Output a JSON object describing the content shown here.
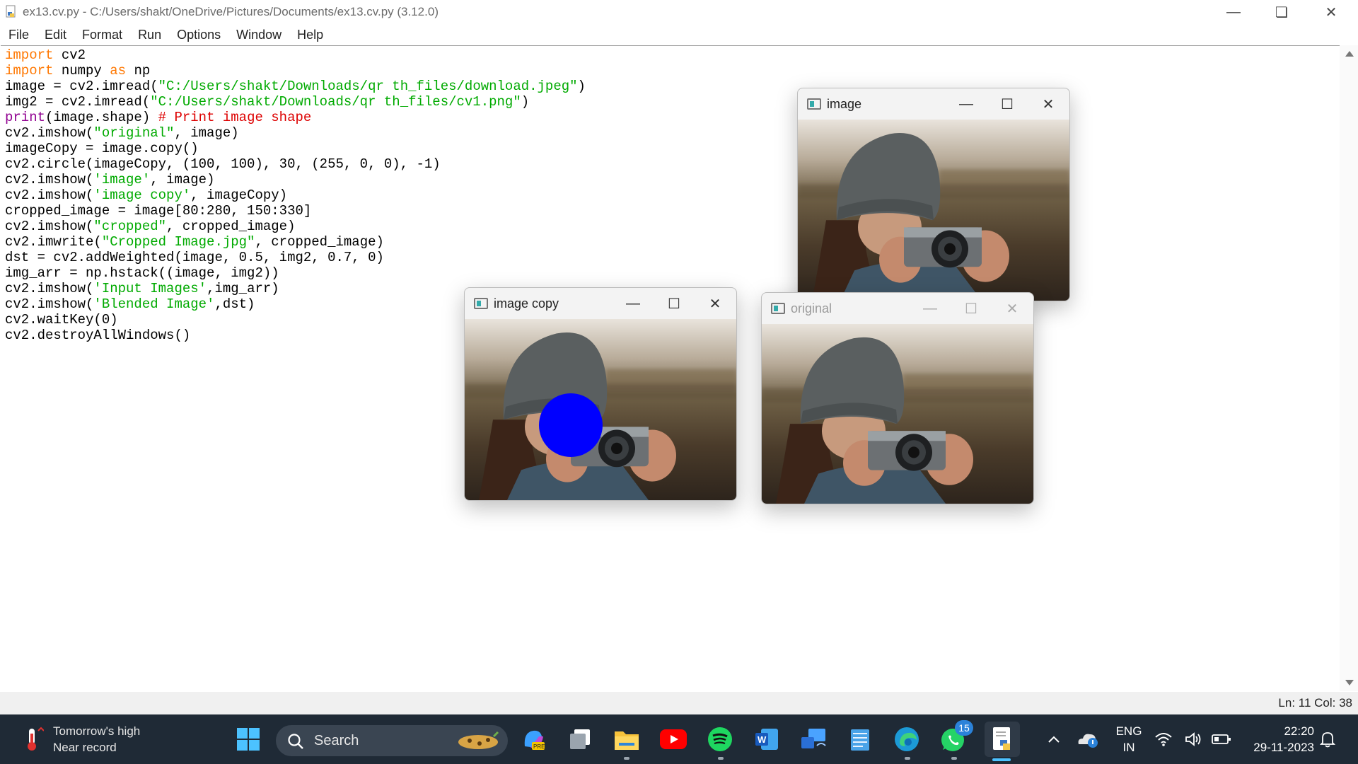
{
  "window": {
    "title": "ex13.cv.py - C:/Users/shakt/OneDrive/Pictures/Documents/ex13.cv.py (3.12.0)",
    "minimize_icon": "minimize-icon",
    "restore_icon": "restore-icon",
    "close_icon": "close-icon"
  },
  "menu": [
    "File",
    "Edit",
    "Format",
    "Run",
    "Options",
    "Window",
    "Help"
  ],
  "code_lines": [
    [
      {
        "t": "import",
        "c": "kw"
      },
      {
        "t": " cv2",
        "c": ""
      }
    ],
    [
      {
        "t": "import",
        "c": "kw"
      },
      {
        "t": " numpy ",
        "c": ""
      },
      {
        "t": "as",
        "c": "kw"
      },
      {
        "t": " np",
        "c": ""
      }
    ],
    [
      {
        "t": "image = cv2.imread(",
        "c": ""
      },
      {
        "t": "\"C:/Users/shakt/Downloads/qr th_files/download.jpeg\"",
        "c": "str"
      },
      {
        "t": ")",
        "c": ""
      }
    ],
    [
      {
        "t": "img2 = cv2.imread(",
        "c": ""
      },
      {
        "t": "\"C:/Users/shakt/Downloads/qr th_files/cv1.png\"",
        "c": "str"
      },
      {
        "t": ")",
        "c": ""
      }
    ],
    [
      {
        "t": "print",
        "c": "bi"
      },
      {
        "t": "(image.shape) ",
        "c": ""
      },
      {
        "t": "# Print image shape",
        "c": "cm"
      }
    ],
    [
      {
        "t": "cv2.imshow(",
        "c": ""
      },
      {
        "t": "\"original\"",
        "c": "str"
      },
      {
        "t": ", image)",
        "c": ""
      }
    ],
    [
      {
        "t": "imageCopy = image.copy()",
        "c": ""
      }
    ],
    [
      {
        "t": "cv2.circle(imageCopy, (100, 100), 30, (255, 0, 0), -1)",
        "c": ""
      }
    ],
    [
      {
        "t": "cv2.imshow(",
        "c": ""
      },
      {
        "t": "'image'",
        "c": "str"
      },
      {
        "t": ", image)",
        "c": ""
      }
    ],
    [
      {
        "t": "cv2.imshow(",
        "c": ""
      },
      {
        "t": "'image copy'",
        "c": "str"
      },
      {
        "t": ", imageCopy)",
        "c": ""
      }
    ],
    [
      {
        "t": "cropped_image = image[80:280, 150:330]",
        "c": ""
      }
    ],
    [
      {
        "t": "cv2.imshow(",
        "c": ""
      },
      {
        "t": "\"cropped\"",
        "c": "str"
      },
      {
        "t": ", cropped_image)",
        "c": ""
      }
    ],
    [
      {
        "t": "cv2.imwrite(",
        "c": ""
      },
      {
        "t": "\"Cropped Image.jpg\"",
        "c": "str"
      },
      {
        "t": ", cropped_image)",
        "c": ""
      }
    ],
    [
      {
        "t": "dst = cv2.addWeighted(image, 0.5, img2, 0.7, 0)",
        "c": ""
      }
    ],
    [
      {
        "t": "img_arr = np.hstack((image, img2))",
        "c": ""
      }
    ],
    [
      {
        "t": "cv2.imshow(",
        "c": ""
      },
      {
        "t": "'Input Images'",
        "c": "str"
      },
      {
        "t": ",img_arr)",
        "c": ""
      }
    ],
    [
      {
        "t": "cv2.imshow(",
        "c": ""
      },
      {
        "t": "'Blended Image'",
        "c": "str"
      },
      {
        "t": ",dst)",
        "c": ""
      }
    ],
    [
      {
        "t": "cv2.waitKey(0)",
        "c": ""
      }
    ],
    [
      {
        "t": "cv2.destroyAllWindows()",
        "c": ""
      }
    ]
  ],
  "status": {
    "position": "Ln: 11   Col: 38"
  },
  "cv_windows": {
    "image": {
      "title": "image"
    },
    "image_copy": {
      "title": "image copy"
    },
    "original": {
      "title": "original"
    }
  },
  "colors": {
    "circle": "#0000ff",
    "taskbar": "#1f2a36",
    "keyword": "#ff7700",
    "string": "#00aa00"
  },
  "taskbar": {
    "weather_line1": "Tomorrow's high",
    "weather_line2": "Near record",
    "search_placeholder": "Search",
    "whatsapp_badge": "15",
    "language_line1": "ENG",
    "language_line2": "IN",
    "time": "22:20",
    "date": "29-11-2023",
    "icons": [
      "thermometer-icon",
      "windows-start-icon",
      "search-icon",
      "copilot-icon",
      "task-view-icon",
      "file-explorer-icon",
      "youtube-icon",
      "spotify-icon",
      "word-icon",
      "cast-icon",
      "notepad-icon",
      "edge-icon",
      "whatsapp-icon",
      "python-idle-icon",
      "chevron-up-icon",
      "onedrive-icon",
      "wifi-icon",
      "volume-icon",
      "battery-icon",
      "bell-icon"
    ]
  }
}
